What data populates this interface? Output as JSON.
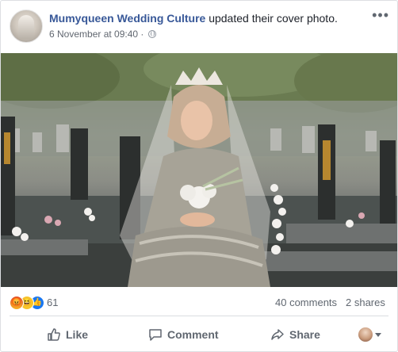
{
  "post": {
    "page_name": "Mumyqueen Wedding Culture",
    "action_text": "updated their cover photo.",
    "timestamp": "6 November at 09:40",
    "privacy_icon": "globe-icon",
    "more_icon": "ellipsis-icon"
  },
  "photo": {
    "subject": "cover-photo"
  },
  "stats": {
    "reaction_icons": [
      "angry",
      "haha",
      "like"
    ],
    "reaction_count": "61",
    "comments": "40 comments",
    "shares": "2 shares"
  },
  "actions": {
    "like": "Like",
    "comment": "Comment",
    "share": "Share"
  },
  "colors": {
    "link": "#385898",
    "muted": "#606770",
    "like_blue": "#1877f2"
  }
}
